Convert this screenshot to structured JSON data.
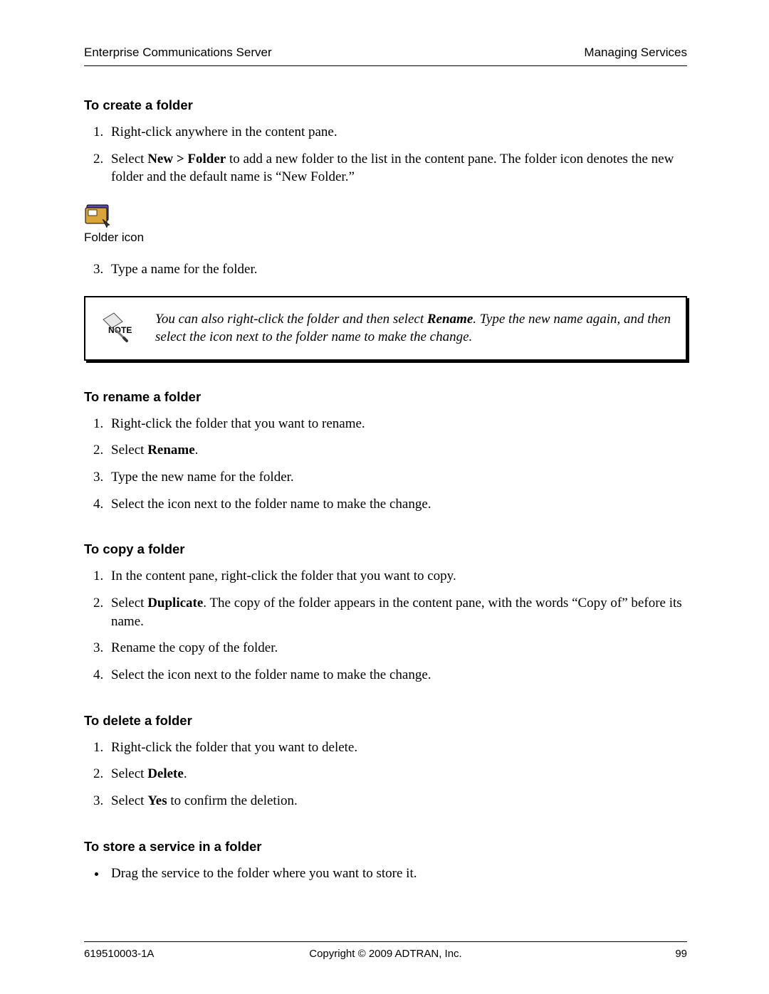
{
  "header": {
    "left": "Enterprise Communications Server",
    "right": "Managing Services"
  },
  "sections": {
    "create": {
      "title": "To create a folder",
      "step1": "Right-click anywhere in the content pane.",
      "step2_prefix": "Select ",
      "step2_bold": "New > Folder",
      "step2_suffix": " to add a new folder to the list in the content pane. The folder icon denotes the new folder and the default name is “New Folder.”",
      "icon_caption": "Folder icon",
      "step3": "Type a name for the folder."
    },
    "note": {
      "label": "NOTE",
      "text_prefix": "You can also right-click the folder and then select ",
      "text_bold": "Rename",
      "text_suffix": ". Type the new name again, and then select the icon next to the folder name to make the change."
    },
    "rename": {
      "title": "To rename a folder",
      "step1": "Right-click the folder that you want to rename.",
      "step2_prefix": "Select ",
      "step2_bold": "Rename",
      "step2_suffix": ".",
      "step3": "Type the new name for the folder.",
      "step4": "Select the icon next to the folder name to make the change."
    },
    "copy": {
      "title": "To copy a folder",
      "step1": "In the content pane, right-click the folder that you want to copy.",
      "step2_prefix": "Select ",
      "step2_bold": "Duplicate",
      "step2_suffix": ". The copy of the folder appears in the content pane, with the words “Copy of” before its name.",
      "step3": "Rename the copy of the folder.",
      "step4": "Select the icon next to the folder name to make the change."
    },
    "delete": {
      "title": "To delete a folder",
      "step1": "Right-click the folder that you want to delete.",
      "step2_prefix": "Select ",
      "step2_bold": "Delete",
      "step2_suffix": ".",
      "step3_prefix": "Select ",
      "step3_bold": "Yes",
      "step3_suffix": " to confirm the deletion."
    },
    "store": {
      "title": "To store a service in a folder",
      "bullet1": "Drag the service to the folder where you want to store it."
    }
  },
  "footer": {
    "left": "619510003-1A",
    "center": "Copyright © 2009 ADTRAN, Inc.",
    "right": "99"
  }
}
